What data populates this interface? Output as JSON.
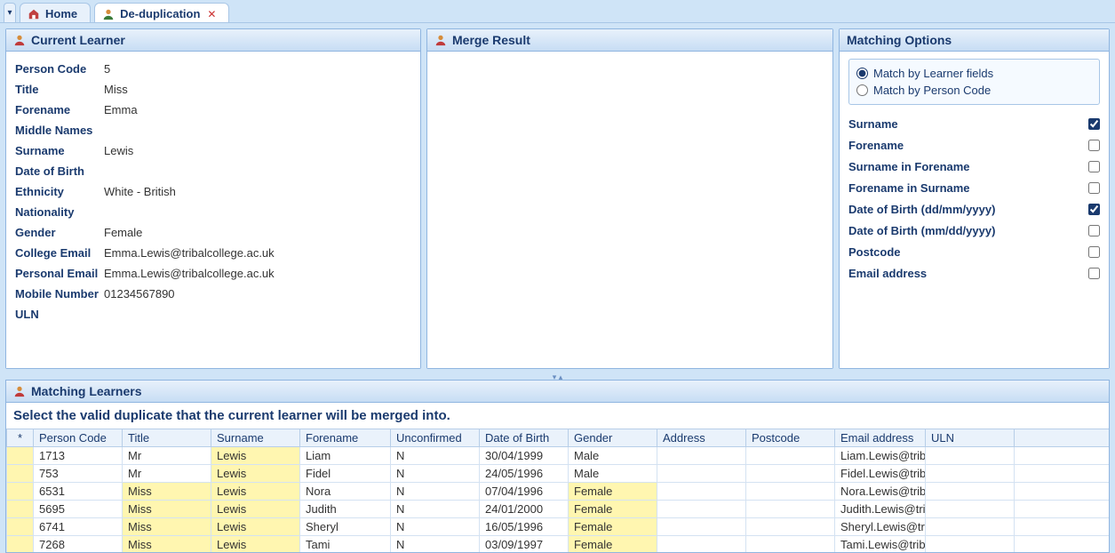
{
  "tabs": {
    "home": "Home",
    "dedup": "De-duplication"
  },
  "panels": {
    "currentLearner": "Current Learner",
    "mergeResult": "Merge Result",
    "matchingOptions": "Matching Options",
    "matchingLearners": "Matching Learners"
  },
  "learner": {
    "labels": {
      "personCode": "Person Code",
      "title": "Title",
      "forename": "Forename",
      "middleNames": "Middle Names",
      "surname": "Surname",
      "dob": "Date of Birth",
      "ethnicity": "Ethnicity",
      "nationality": "Nationality",
      "gender": "Gender",
      "collegeEmail": "College Email",
      "personalEmail": "Personal Email",
      "mobileNumber": "Mobile Number",
      "uln": "ULN"
    },
    "values": {
      "personCode": "5",
      "title": "Miss",
      "forename": "Emma",
      "middleNames": "",
      "surname": "Lewis",
      "dob": "",
      "ethnicity": "White - British",
      "nationality": "",
      "gender": "Female",
      "collegeEmail": "Emma.Lewis@tribalcollege.ac.uk",
      "personalEmail": "Emma.Lewis@tribalcollege.ac.uk",
      "mobileNumber": "01234567890",
      "uln": ""
    }
  },
  "matchOptions": {
    "radios": {
      "byFields": "Match by Learner fields",
      "byCode": "Match by Person Code",
      "selected": "byFields"
    },
    "checks": [
      {
        "label": "Surname",
        "checked": true
      },
      {
        "label": "Forename",
        "checked": false
      },
      {
        "label": "Surname in Forename",
        "checked": false
      },
      {
        "label": "Forename in Surname",
        "checked": false
      },
      {
        "label": "Date of Birth (dd/mm/yyyy)",
        "checked": true
      },
      {
        "label": "Date of Birth (mm/dd/yyyy)",
        "checked": false
      },
      {
        "label": "Postcode",
        "checked": false
      },
      {
        "label": "Email address",
        "checked": false
      }
    ]
  },
  "matching": {
    "instruction": "Select the valid duplicate that the current learner will be merged into.",
    "starHeader": "*",
    "cols": [
      "Person Code",
      "Title",
      "Surname",
      "Forename",
      "Unconfirmed",
      "Date of Birth",
      "Gender",
      "Address",
      "Postcode",
      "Email address",
      "ULN"
    ],
    "rows": [
      {
        "pc": "1713",
        "title": "Mr",
        "sur": "Lewis",
        "fore": "Liam",
        "un": "N",
        "dob": "30/04/1999",
        "gender": "Male",
        "addr": "",
        "post": "",
        "email": "Liam.Lewis@tribalc",
        "uln": "",
        "hl": {
          "title": false,
          "sur": true,
          "gender": false
        }
      },
      {
        "pc": "753",
        "title": "Mr",
        "sur": "Lewis",
        "fore": "Fidel",
        "un": "N",
        "dob": "24/05/1996",
        "gender": "Male",
        "addr": "",
        "post": "",
        "email": "Fidel.Lewis@tribalc",
        "uln": "",
        "hl": {
          "title": false,
          "sur": true,
          "gender": false
        }
      },
      {
        "pc": "6531",
        "title": "Miss",
        "sur": "Lewis",
        "fore": "Nora",
        "un": "N",
        "dob": "07/04/1996",
        "gender": "Female",
        "addr": "",
        "post": "",
        "email": "Nora.Lewis@tribal",
        "uln": "",
        "hl": {
          "title": true,
          "sur": true,
          "gender": true
        }
      },
      {
        "pc": "5695",
        "title": "Miss",
        "sur": "Lewis",
        "fore": "Judith",
        "un": "N",
        "dob": "24/01/2000",
        "gender": "Female",
        "addr": "",
        "post": "",
        "email": "Judith.Lewis@triba",
        "uln": "",
        "hl": {
          "title": true,
          "sur": true,
          "gender": true
        }
      },
      {
        "pc": "6741",
        "title": "Miss",
        "sur": "Lewis",
        "fore": "Sheryl",
        "un": "N",
        "dob": "16/05/1996",
        "gender": "Female",
        "addr": "",
        "post": "",
        "email": "Sheryl.Lewis@triba",
        "uln": "",
        "hl": {
          "title": true,
          "sur": true,
          "gender": true
        }
      },
      {
        "pc": "7268",
        "title": "Miss",
        "sur": "Lewis",
        "fore": "Tami",
        "un": "N",
        "dob": "03/09/1997",
        "gender": "Female",
        "addr": "",
        "post": "",
        "email": "Tami.Lewis@tribalc",
        "uln": "",
        "hl": {
          "title": true,
          "sur": true,
          "gender": true
        }
      }
    ]
  }
}
